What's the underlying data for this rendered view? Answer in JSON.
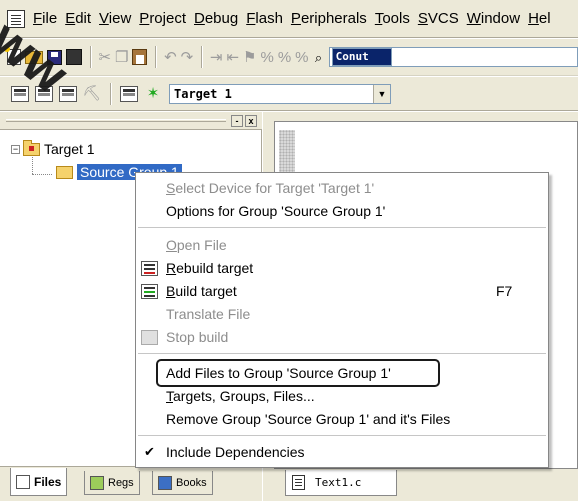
{
  "menubar": {
    "items": [
      "File",
      "Edit",
      "View",
      "Project",
      "Debug",
      "Flash",
      "Peripherals",
      "Tools",
      "SVCS",
      "Window",
      "Hel"
    ]
  },
  "toolbar": {
    "find_value": "Conut"
  },
  "build_toolbar": {
    "target_value": "Target 1"
  },
  "project_tree": {
    "root_label": "Target 1",
    "group_label": "Source Group 1",
    "close_glyph": "x",
    "pin_glyph": "-"
  },
  "bottom_tabs": {
    "files": "Files",
    "regs": "Regs",
    "books": "Books"
  },
  "editor": {
    "tab_label": "Text1.c"
  },
  "context_menu": {
    "items": [
      {
        "label": "Select Device for Target 'Target 1'",
        "enabled": false
      },
      {
        "label": "Options for Group 'Source Group 1'",
        "enabled": true
      },
      {
        "label": "Open File",
        "enabled": false
      },
      {
        "label": "Rebuild target",
        "enabled": true,
        "icon": "rebuild-icon"
      },
      {
        "label": "Build target",
        "enabled": true,
        "icon": "build-icon",
        "shortcut": "F7"
      },
      {
        "label": "Translate File",
        "enabled": false
      },
      {
        "label": "Stop build",
        "enabled": false,
        "icon": "stop-build-icon"
      },
      {
        "label": "Add Files to Group 'Source Group 1'",
        "enabled": true,
        "highlighted": true
      },
      {
        "label": "Targets, Groups, Files...",
        "enabled": true
      },
      {
        "label": "Remove Group 'Source Group 1' and it's Files",
        "enabled": true
      },
      {
        "label": "Include Dependencies",
        "enabled": true,
        "checked": true
      }
    ]
  },
  "watermark": "WW"
}
